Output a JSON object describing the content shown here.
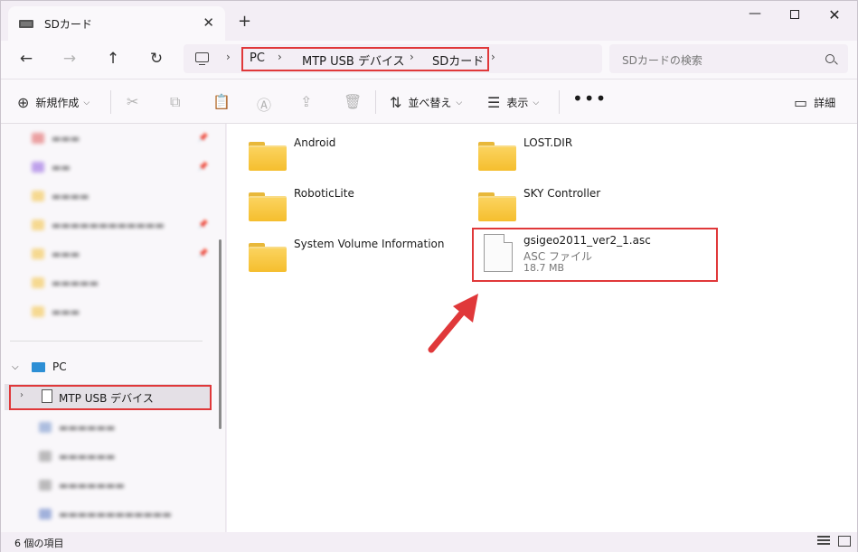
{
  "tab": {
    "title": "SDカード",
    "close": "✕",
    "new_tab": "+"
  },
  "window_controls": {
    "minimize": "—",
    "close": "✕"
  },
  "nav": {
    "back": "←",
    "forward": "→",
    "up": "↑",
    "refresh": "↻"
  },
  "breadcrumb": [
    "PC",
    "MTP USB デバイス",
    "SDカード"
  ],
  "breadcrumb_sep": "›",
  "search": {
    "placeholder": "SDカードの検索"
  },
  "commands": {
    "new": "新規作成",
    "sort": "並べ替え",
    "view": "表示",
    "more": "•••",
    "details": "詳細"
  },
  "sidebar": {
    "pc_label": "PC",
    "mtp_label": "MTP USB デバイス"
  },
  "folders": [
    "Android",
    "LOST.DIR",
    "RoboticLite",
    "SKY Controller",
    "System Volume Information"
  ],
  "file": {
    "name": "gsigeo2011_ver2_1.asc",
    "type": "ASC ファイル",
    "size": "18.7 MB"
  },
  "status": {
    "count": "6 個の項目"
  },
  "colors": {
    "highlight": "#e0383a",
    "folder": "#f5be2e",
    "pc_icon": "#2d8fd5"
  }
}
